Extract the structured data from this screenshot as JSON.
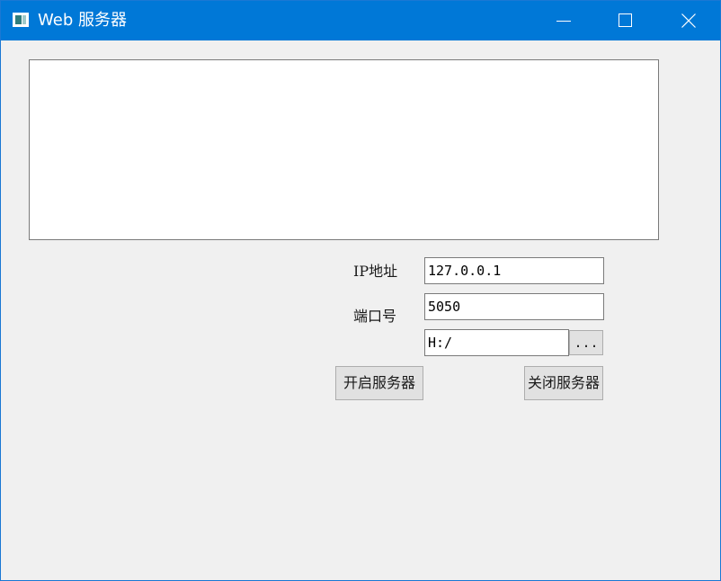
{
  "window": {
    "title": "Web 服务器",
    "icon": "app-window-icon",
    "controls": {
      "minimize_icon": "minimize-icon",
      "maximize_icon": "maximize-icon",
      "close_icon": "close-icon"
    },
    "titlebar_color": "#0078d7"
  },
  "log": {
    "content": ""
  },
  "form": {
    "ip_label": "IP地址",
    "ip_value": "127.0.0.1",
    "port_label": "端口号",
    "port_value": "5050",
    "path_value": "H:/",
    "browse_label": "..."
  },
  "actions": {
    "start_label": "开启服务器",
    "stop_label": "关闭服务器"
  }
}
